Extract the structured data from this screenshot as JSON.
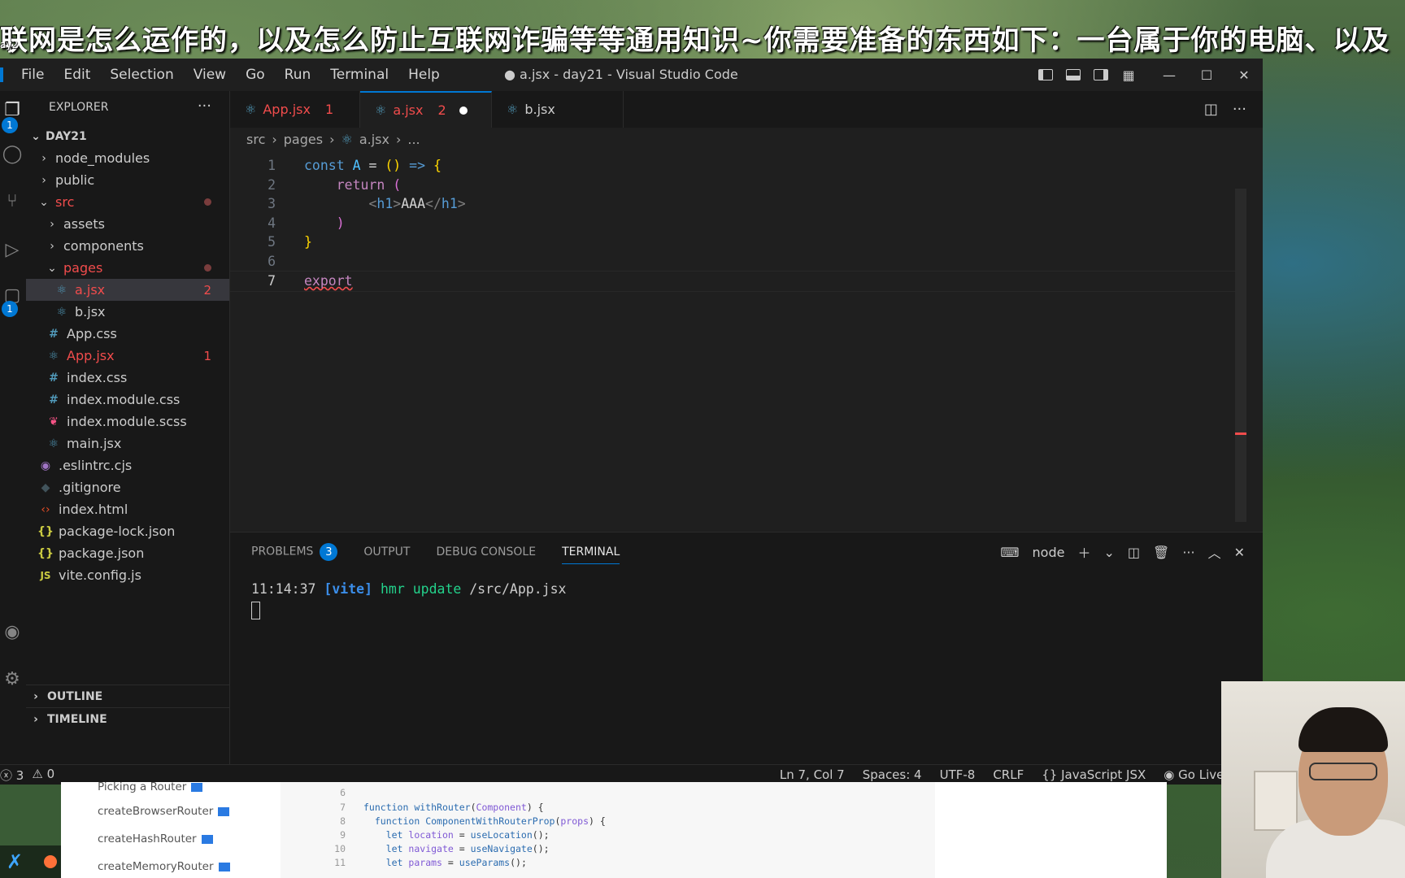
{
  "overlay": {
    "subtitle": "联网是怎么运作的，以及怎么防止互联网诈骗等等通用知识~你需要准备的东西如下：一台属于你的电脑、以及",
    "corner_label": "ay2"
  },
  "window": {
    "title": "● a.jsx - day21 - Visual Studio Code",
    "menu": [
      "File",
      "Edit",
      "Selection",
      "View",
      "Go",
      "Run",
      "Terminal",
      "Help"
    ]
  },
  "activity_bar": {
    "explorer_badge": "1",
    "extensions_badge": "1"
  },
  "sidebar": {
    "header": "EXPLORER",
    "more": "···",
    "root": "DAY21",
    "items": [
      {
        "label": "node_modules",
        "indent": 1,
        "type": "folder",
        "open": false
      },
      {
        "label": "public",
        "indent": 1,
        "type": "folder",
        "open": false
      },
      {
        "label": "src",
        "indent": 1,
        "type": "folder",
        "open": true,
        "modified": true
      },
      {
        "label": "assets",
        "indent": 2,
        "type": "folder",
        "open": false
      },
      {
        "label": "components",
        "indent": 2,
        "type": "folder",
        "open": false
      },
      {
        "label": "pages",
        "indent": 2,
        "type": "folder",
        "open": true,
        "modified": true
      },
      {
        "label": "a.jsx",
        "indent": 3,
        "type": "react",
        "badge": "2",
        "selected": true,
        "error": true
      },
      {
        "label": "b.jsx",
        "indent": 3,
        "type": "react"
      },
      {
        "label": "App.css",
        "indent": 2,
        "type": "css"
      },
      {
        "label": "App.jsx",
        "indent": 2,
        "type": "react",
        "badge": "1",
        "error": true
      },
      {
        "label": "index.css",
        "indent": 2,
        "type": "css"
      },
      {
        "label": "index.module.css",
        "indent": 2,
        "type": "css"
      },
      {
        "label": "index.module.scss",
        "indent": 2,
        "type": "scss"
      },
      {
        "label": "main.jsx",
        "indent": 2,
        "type": "react"
      },
      {
        "label": ".eslintrc.cjs",
        "indent": 1,
        "type": "eslint"
      },
      {
        "label": ".gitignore",
        "indent": 1,
        "type": "git"
      },
      {
        "label": "index.html",
        "indent": 1,
        "type": "html"
      },
      {
        "label": "package-lock.json",
        "indent": 1,
        "type": "json"
      },
      {
        "label": "package.json",
        "indent": 1,
        "type": "json"
      },
      {
        "label": "vite.config.js",
        "indent": 1,
        "type": "js"
      }
    ],
    "outline": "OUTLINE",
    "timeline": "TIMELINE"
  },
  "tabs": [
    {
      "label": "App.jsx",
      "badge": "1",
      "active": false,
      "error": true
    },
    {
      "label": "a.jsx",
      "badge": "2",
      "active": true,
      "error": true,
      "dirty": true
    },
    {
      "label": "b.jsx",
      "active": false
    }
  ],
  "breadcrumb": [
    "src",
    "pages",
    "a.jsx",
    "..."
  ],
  "code": {
    "current_line": 7,
    "lines": [
      "1",
      "2",
      "3",
      "4",
      "5",
      "6",
      "7"
    ]
  },
  "panel": {
    "tabs": [
      "PROBLEMS",
      "OUTPUT",
      "DEBUG CONSOLE",
      "TERMINAL"
    ],
    "problems_count": "3",
    "active_tab": "TERMINAL",
    "terminal_name": "node",
    "terminal": {
      "time": "11:14:37",
      "tag": "[vite]",
      "action": "hmr update",
      "path": "/src/App.jsx"
    }
  },
  "statusbar": {
    "errors": "3",
    "warnings": "0",
    "position": "Ln 7, Col 7",
    "spaces": "Spaces: 4",
    "encoding": "UTF-8",
    "eol": "CRLF",
    "language": "JavaScript JSX",
    "golive": "Go Live"
  },
  "browser": {
    "links": [
      "Picking a Router",
      "createBrowserRouter",
      "createHashRouter",
      "createMemoryRouter"
    ],
    "code_line_numbers": [
      "6",
      "7",
      "8",
      "9",
      "10",
      "11"
    ]
  },
  "colors": {
    "accent": "#0078d4",
    "error": "#f14c4c"
  }
}
